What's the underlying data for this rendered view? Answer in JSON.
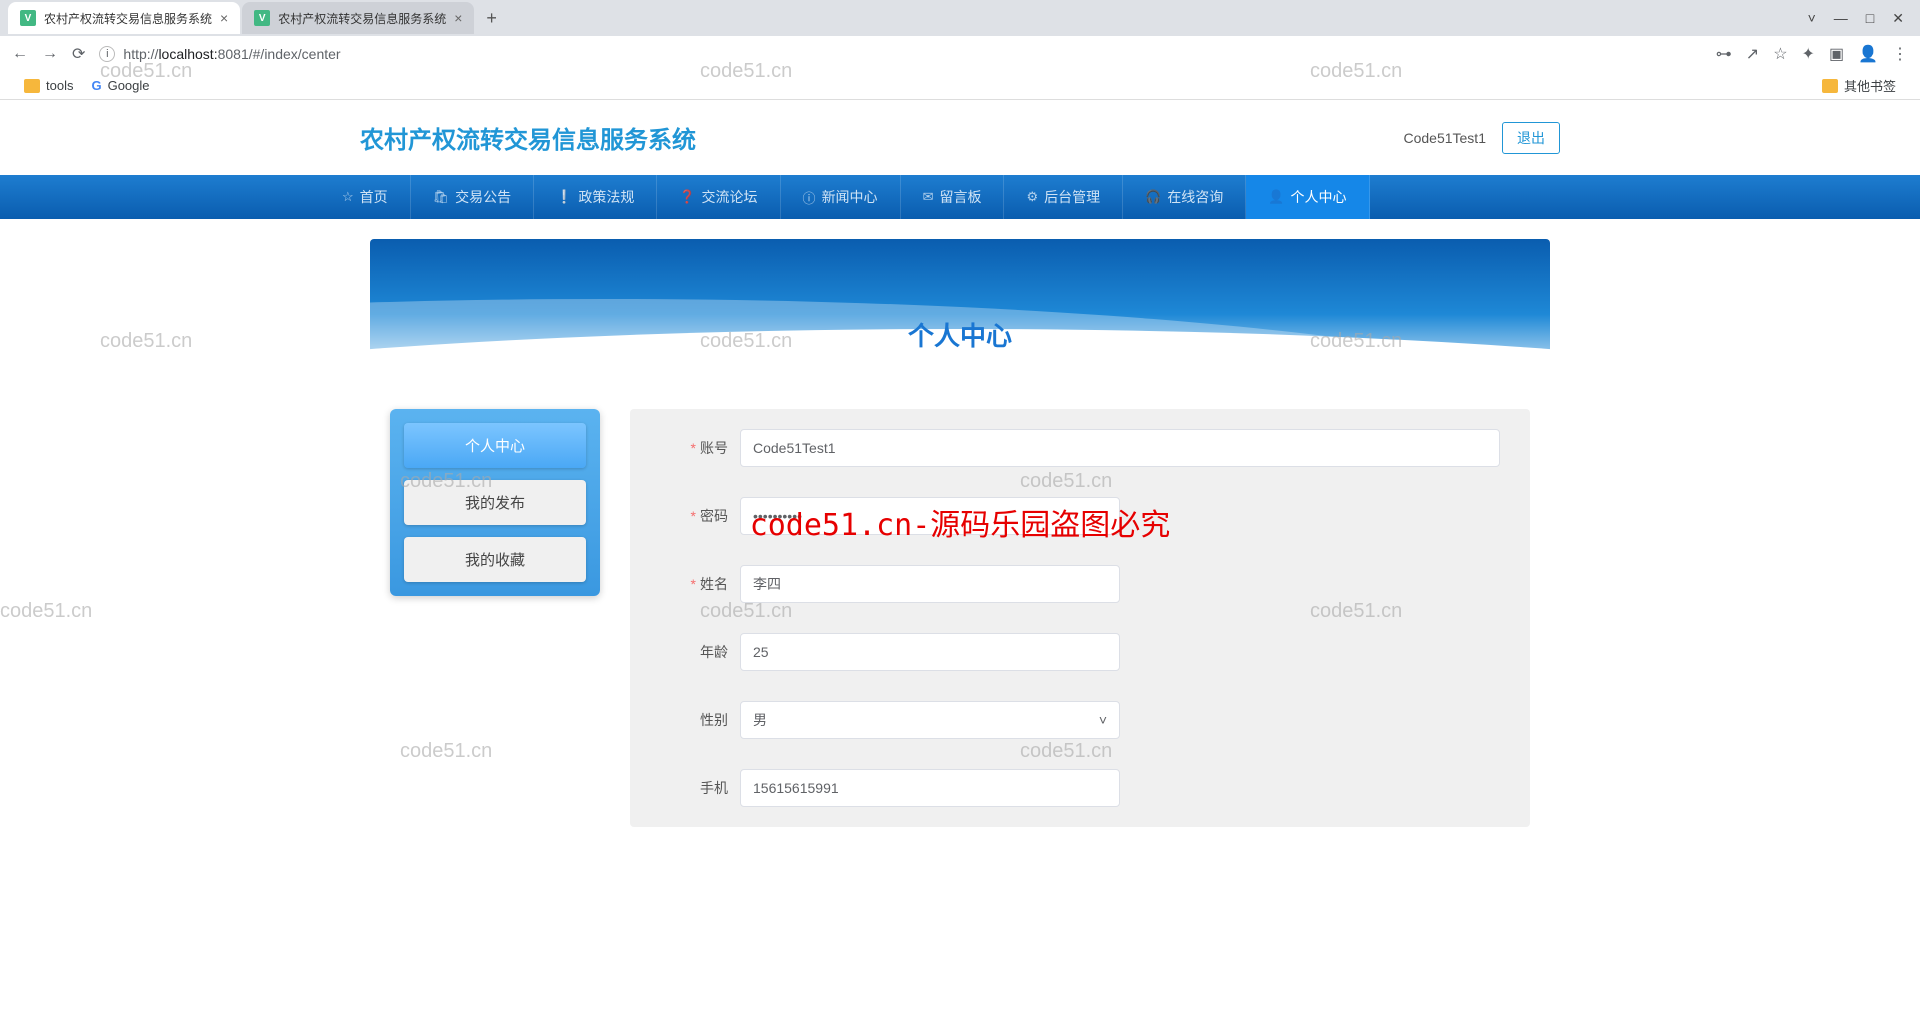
{
  "browser": {
    "tabs": [
      {
        "title": "农村产权流转交易信息服务系统",
        "active": true
      },
      {
        "title": "农村产权流转交易信息服务系统",
        "active": false
      }
    ],
    "url_prefix": "http://",
    "url_host": "localhost:",
    "url_port": "8081",
    "url_path": "/#/index/center",
    "bookmarks": {
      "tools": "tools",
      "google": "Google",
      "other": "其他书签"
    },
    "window": {
      "dropdown": "˅",
      "min": "—",
      "max": "□",
      "close": "✕"
    }
  },
  "header": {
    "title": "农村产权流转交易信息服务系统",
    "username": "Code51Test1",
    "logout": "退出"
  },
  "nav": {
    "items": [
      {
        "icon": "☆",
        "label": "首页"
      },
      {
        "icon": "🛍",
        "label": "交易公告"
      },
      {
        "icon": "❕",
        "label": "政策法规"
      },
      {
        "icon": "❓",
        "label": "交流论坛"
      },
      {
        "icon": "ⓘ",
        "label": "新闻中心"
      },
      {
        "icon": "✉",
        "label": "留言板"
      },
      {
        "icon": "⚙",
        "label": "后台管理"
      },
      {
        "icon": "🎧",
        "label": "在线咨询"
      },
      {
        "icon": "👤",
        "label": "个人中心"
      }
    ],
    "active_index": 8
  },
  "banner": {
    "title": "个人中心"
  },
  "sidebar": {
    "items": [
      "个人中心",
      "我的发布",
      "我的收藏"
    ],
    "active_index": 0
  },
  "form": {
    "account": {
      "label": "账号",
      "value": "Code51Test1",
      "required": true
    },
    "password": {
      "label": "密码",
      "value": "••••••••••",
      "required": true
    },
    "name": {
      "label": "姓名",
      "value": "李四",
      "required": true
    },
    "age": {
      "label": "年龄",
      "value": "25",
      "required": false
    },
    "gender": {
      "label": "性别",
      "value": "男",
      "required": false
    },
    "phone": {
      "label": "手机",
      "value": "15615615991",
      "required": false
    }
  },
  "overlay": "code51.cn-源码乐园盗图必究",
  "watermark": "code51.cn"
}
